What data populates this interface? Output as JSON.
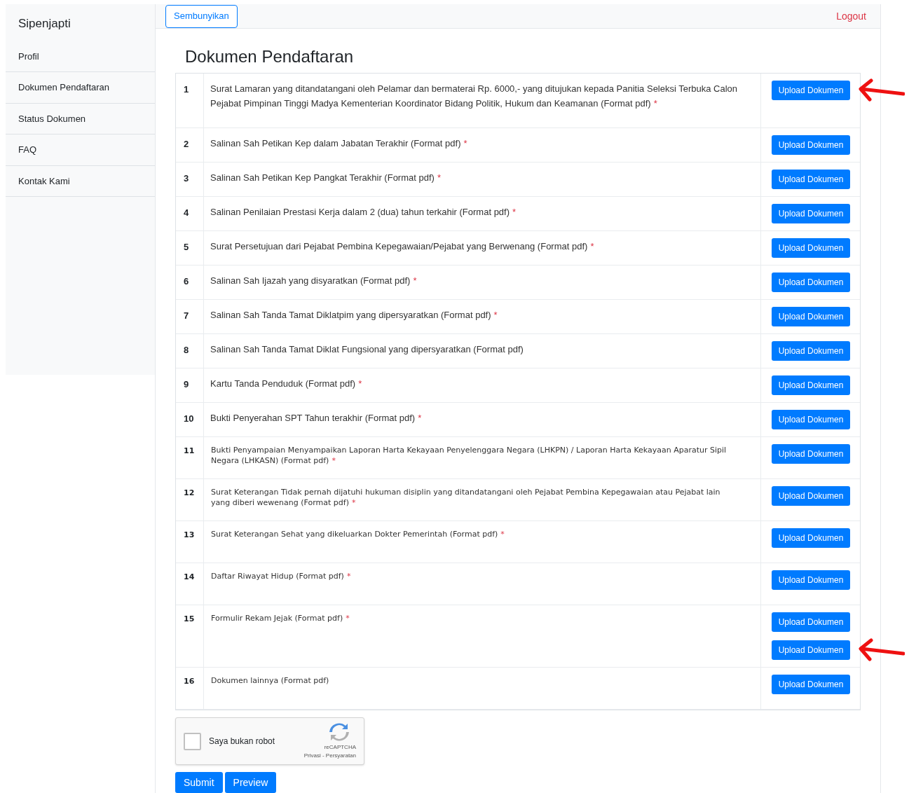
{
  "sidebar": {
    "brand": "Sipenjapti",
    "items": [
      {
        "label": "Profil",
        "selected": false
      },
      {
        "label": "Dokumen Pendaftaran",
        "selected": false
      },
      {
        "label": "Status Dokumen",
        "selected": false
      },
      {
        "label": "FAQ",
        "selected": false
      },
      {
        "label": "Kontak Kami",
        "selected": false
      }
    ]
  },
  "topbar": {
    "toggle_button": "Sembunyikan",
    "logout": "Logout"
  },
  "title": "Dokumen Pendaftaran",
  "rows": [
    {
      "number": "1",
      "kind": "large",
      "text": "Surat Lamaran yang ditandatangani oleh Pelamar dan bermaterai Rp. 6000,- yang ditujukan kepada Panitia Seleksi Terbuka Calon Pejabat Pimpinan Tinggi Madya Kementerian Koordinator Bidang Politik, Hukum dan Keamanan (Format pdf)",
      "required_mark": "*",
      "buttons": [
        {
          "label": "Upload Dokumen",
          "marked": true
        }
      ]
    },
    {
      "number": "2",
      "kind": "large",
      "text": "Salinan Sah Petikan Kep dalam Jabatan Terakhir (Format pdf)",
      "required_mark": "*",
      "buttons": [
        {
          "label": "Upload Dokumen",
          "marked": false
        }
      ]
    },
    {
      "number": "3",
      "kind": "large",
      "text": "Salinan Sah Petikan Kep Pangkat Terakhir (Format pdf)",
      "required_mark": "*",
      "buttons": [
        {
          "label": "Upload Dokumen",
          "marked": false
        }
      ]
    },
    {
      "number": "4",
      "kind": "large",
      "text": "Salinan Penilaian Prestasi Kerja dalam 2 (dua) tahun terkahir (Format pdf)",
      "required_mark": "*",
      "buttons": [
        {
          "label": "Upload Dokumen",
          "marked": false
        }
      ]
    },
    {
      "number": "5",
      "kind": "large",
      "text": "Surat Persetujuan dari Pejabat Pembina Kepegawaian/Pejabat yang Berwenang (Format pdf)",
      "required_mark": "*",
      "buttons": [
        {
          "label": "Upload Dokumen",
          "marked": false
        }
      ]
    },
    {
      "number": "6",
      "kind": "large",
      "text": "Salinan Sah Ijazah yang disyaratkan (Format pdf)",
      "required_mark": "*",
      "buttons": [
        {
          "label": "Upload Dokumen",
          "marked": false
        }
      ]
    },
    {
      "number": "7",
      "kind": "large",
      "text": "Salinan Sah Tanda Tamat Diklatpim yang dipersyaratkan (Format pdf)",
      "required_mark": "*",
      "buttons": [
        {
          "label": "Upload Dokumen",
          "marked": false
        }
      ]
    },
    {
      "number": "8",
      "kind": "large",
      "text": "Salinan Sah Tanda Tamat Diklat Fungsional yang dipersyaratkan (Format pdf)",
      "buttons": [
        {
          "label": "Upload Dokumen",
          "marked": false
        }
      ]
    },
    {
      "number": "9",
      "kind": "large",
      "text": "Kartu Tanda Penduduk (Format pdf)",
      "required_mark": "*",
      "buttons": [
        {
          "label": "Upload Dokumen",
          "marked": false
        }
      ]
    },
    {
      "number": "10",
      "kind": "large",
      "text": "Bukti Penyerahan SPT Tahun terakhir (Format pdf)",
      "required_mark": "*",
      "buttons": [
        {
          "label": "Upload Dokumen",
          "marked": false
        }
      ]
    },
    {
      "number": "11",
      "kind": "small",
      "text": "Bukti Penyampaian Menyampaikan Laporan Harta Kekayaan Penyelenggara Negara (LHKPN) / Laporan Harta Kekayaan Aparatur Sipil Negara (LHKASN) (Format pdf)",
      "required_mark": "*",
      "buttons": [
        {
          "label": "Upload Dokumen",
          "marked": false
        }
      ]
    },
    {
      "number": "12",
      "kind": "small",
      "text": "Surat Keterangan Tidak pernah dijatuhi hukuman disiplin yang ditandatangani oleh Pejabat Pembina Kepegawaian atau Pejabat lain yang diberi wewenang (Format pdf)",
      "required_mark": "*",
      "buttons": [
        {
          "label": "Upload Dokumen",
          "marked": false
        }
      ]
    },
    {
      "number": "13",
      "kind": "small",
      "text": "Surat Keterangan Sehat yang dikeluarkan Dokter Pemerintah (Format pdf)",
      "required_mark": "*",
      "buttons": [
        {
          "label": "Upload Dokumen",
          "marked": false
        }
      ]
    },
    {
      "number": "14",
      "kind": "small",
      "text": "Daftar Riwayat Hidup (Format pdf)",
      "required_mark": "*",
      "buttons": [
        {
          "label": "Upload Dokumen",
          "marked": false
        }
      ]
    },
    {
      "number": "15",
      "kind": "small",
      "text": "Formulir Rekam Jejak (Format pdf)",
      "required_mark": "*",
      "buttons": [
        {
          "label": "Upload Dokumen",
          "marked": false
        },
        {
          "label": "Upload Dokumen",
          "marked": true
        }
      ]
    },
    {
      "number": "16",
      "kind": "small",
      "text": "Dokumen lainnya (Format pdf)",
      "buttons": [
        {
          "label": "Upload Dokumen",
          "marked": false
        }
      ]
    }
  ],
  "captcha": {
    "label": "Saya bukan robot",
    "checked": false,
    "brand": "reCAPTCHA",
    "links": "Privasi - Persyaratan"
  },
  "actions": [
    "Submit",
    "Preview"
  ]
}
